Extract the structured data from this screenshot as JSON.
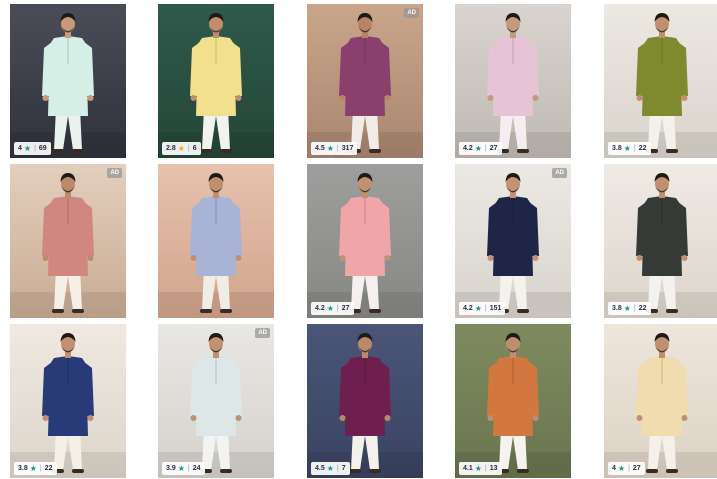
{
  "colors": {
    "star_teal": "#14958f",
    "star_gold": "#f5a623",
    "rating_text": "#282c3f"
  },
  "products": [
    {
      "rating": "4",
      "count": "69",
      "star": "teal",
      "ad": false,
      "bg": "#4a4d58",
      "bg2": "#2f323b",
      "kurta": "#d6efe6",
      "pants": "#e9f2ee",
      "skin": "#c99a7a"
    },
    {
      "rating": "2.8",
      "count": "6",
      "star": "gold",
      "ad": false,
      "bg": "#2f5a4c",
      "bg2": "#244638",
      "kurta": "#f1e08e",
      "pants": "#f3f3ee",
      "skin": "#c08e6e"
    },
    {
      "rating": "4.5",
      "count": "317",
      "star": "teal",
      "ad": true,
      "bg": "#c9a58a",
      "bg2": "#a98670",
      "kurta": "#8b3f6e",
      "pants": "#f1ece7",
      "skin": "#b98465"
    },
    {
      "rating": "4.2",
      "count": "27",
      "star": "teal",
      "ad": false,
      "bg": "#d9d4cf",
      "bg2": "#bfb9b3",
      "kurta": "#e7c3d6",
      "pants": "#f5eef1",
      "skin": "#c39a7d"
    },
    {
      "rating": "3.8",
      "count": "22",
      "star": "teal",
      "ad": false,
      "bg": "#ece8e2",
      "bg2": "#d9d4cc",
      "kurta": "#7f8a2e",
      "pants": "#f4f1ea",
      "skin": "#c2906f"
    },
    {
      "rating": "",
      "count": "",
      "star": "teal",
      "ad": true,
      "bg": "#e3cfbd",
      "bg2": "#c9ab93",
      "kurta": "#d0877f",
      "pants": "#f6efe8",
      "skin": "#bb8a6a"
    },
    {
      "rating": "",
      "count": "",
      "star": "teal",
      "ad": false,
      "bg": "#e6c2ad",
      "bg2": "#d2a48c",
      "kurta": "#a9b3d6",
      "pants": "#f0ece6",
      "skin": "#bf8f70"
    },
    {
      "rating": "4.2",
      "count": "27",
      "star": "teal",
      "ad": false,
      "bg": "#9e9e9c",
      "bg2": "#878784",
      "kurta": "#f0a6a8",
      "pants": "#f5efee",
      "skin": "#c19272"
    },
    {
      "rating": "4.2",
      "count": "151",
      "star": "teal",
      "ad": true,
      "bg": "#ece9e4",
      "bg2": "#d8d3cc",
      "kurta": "#1e2547",
      "pants": "#f4f2ee",
      "skin": "#c39373"
    },
    {
      "rating": "3.8",
      "count": "22",
      "star": "teal",
      "ad": false,
      "bg": "#efeae4",
      "bg2": "#dcd5cc",
      "kurta": "#363a36",
      "pants": "#f4f2ee",
      "skin": "#c29070"
    },
    {
      "rating": "3.8",
      "count": "22",
      "star": "teal",
      "ad": false,
      "bg": "#efe9e1",
      "bg2": "#ddd5ca",
      "kurta": "#283a78",
      "pants": "#f3f0ea",
      "skin": "#c29070"
    },
    {
      "rating": "3.9",
      "count": "24",
      "star": "teal",
      "ad": true,
      "bg": "#e9e7e3",
      "bg2": "#d5d2cd",
      "kurta": "#dde7e8",
      "pants": "#f3f3f1",
      "skin": "#c19272"
    },
    {
      "rating": "4.5",
      "count": "7",
      "star": "teal",
      "ad": false,
      "bg": "#4a5578",
      "bg2": "#3a4362",
      "kurta": "#6e1f4f",
      "pants": "#f4f0ea",
      "skin": "#b9896a"
    },
    {
      "rating": "4.1",
      "count": "13",
      "star": "teal",
      "ad": false,
      "bg": "#7e8a5e",
      "bg2": "#6a7550",
      "kurta": "#d1773f",
      "pants": "#f6f3ee",
      "skin": "#c08e6e"
    },
    {
      "rating": "4",
      "count": "27",
      "star": "teal",
      "ad": false,
      "bg": "#ede6dc",
      "bg2": "#ddd2c4",
      "kurta": "#f0dcae",
      "pants": "#f5f1ea",
      "skin": "#c29070"
    }
  ]
}
